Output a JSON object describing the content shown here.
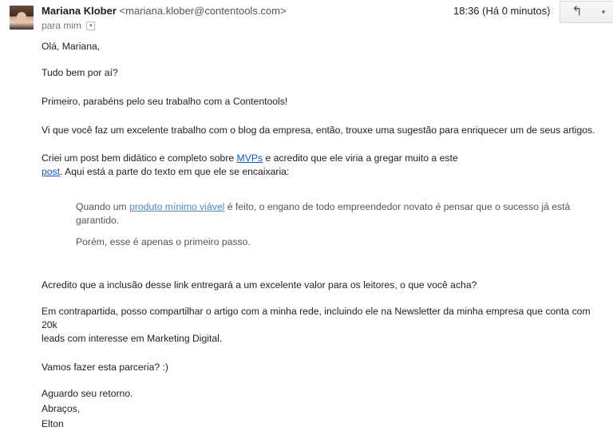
{
  "header": {
    "sender_name": "Mariana Klober",
    "sender_email": "<mariana.klober@contentools.com>",
    "recipient_label": "para mim",
    "timestamp": "18:36 (Há 0 minutos)",
    "star_glyph": "☆",
    "reply_glyph": "↰",
    "more_glyph": "▾"
  },
  "body": {
    "greeting": "Olá, Mariana,",
    "p1": "Tudo bem por aí?",
    "p2": "Primeiro, parabéns pelo seu trabalho com a Contentools!",
    "p3": "Vi que você faz um excelente trabalho com o blog da empresa, então, trouxe uma sugestão para enriquecer um de seus artigos.",
    "p4_before": "Criei um post bem didático e completo sobre ",
    "p4_link1": "MVPs",
    "p4_mid": " e acredito que ele viria a gregar muito a este",
    "p4_link2": "post",
    "p4_after": ". Aqui está a parte do texto em que ele se encaixaria:",
    "quote_before": "Quando um ",
    "quote_link": "produto mínimo viável",
    "quote_after": " é feito, o engano de todo empreendedor novato é pensar que o sucesso já está garantido.",
    "quote_line2": "Porém, esse é apenas o primeiro passo.",
    "p5": "Acredito que a inclusão desse link entregará a um excelente valor para os leitores, o que você acha?",
    "p6_line1": "Em contrapartida, posso compartilhar o artigo com a minha rede, incluindo ele na Newsletter da minha empresa que conta com 20k",
    "p6_line2": "leads com interesse em Marketing Digital.",
    "p7": "Vamos fazer esta parceria? :)",
    "closing1": "Aguardo seu retorno.",
    "closing2": "Abraços,",
    "signature": "Elton"
  }
}
